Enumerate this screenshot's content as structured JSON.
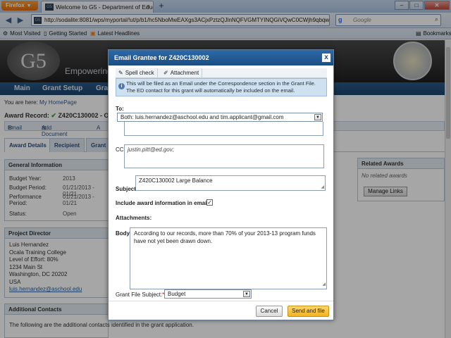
{
  "browser": {
    "app_button": "Firefox",
    "tab_title": "Welcome to G5 - Department of Educatio...",
    "tab_close": "×",
    "new_tab": "+",
    "url": "http://sodalite:8081/wps/myportal/!ut/p/b1/hc5NboMwEAXgs3ACjxPztzQJlnNQFVGMTYINQGiVQwC0CWjh9qbqw",
    "search_placeholder": "Google",
    "window_controls": {
      "minimize": "–",
      "maximize": "□",
      "close": "✕"
    },
    "bookmarks": [
      "Most Visited",
      "Getting Started",
      "Latest Headlines"
    ],
    "bookmarks_menu": "Bookmarks"
  },
  "site": {
    "logo_text": "G5",
    "tagline": "Empowering",
    "nav": [
      "Main",
      "Grant Setup",
      "Gra"
    ],
    "breadcrumb_prefix": "You are here:",
    "breadcrumb_link": "My HomePage",
    "award_record": "Award Record:",
    "award_id": "Z420C130002 - Oca",
    "actions": [
      "Email",
      "Add Document",
      "A"
    ],
    "tabs": [
      "Award Details",
      "Recipient",
      "Grant"
    ],
    "general_info": {
      "title": "General Information",
      "rows": [
        {
          "label": "Budget Year:",
          "value": "2013"
        },
        {
          "label": "Budget Period:",
          "value": "01/21/2013 - 01/21"
        },
        {
          "label": "Performance Period:",
          "value": "01/21/2013 - 01/21"
        },
        {
          "label": "Status:",
          "value": "Open"
        }
      ]
    },
    "project_director": {
      "title": "Project Director",
      "lines": [
        "Luis Hernandez",
        "Ocala Training College",
        "Level of Effort: 80%",
        "1234 Main St",
        "Washington, DC 20202",
        "USA",
        "luis.hernandez@aschool.edu"
      ]
    },
    "additional_contacts": {
      "title": "Additional Contacts",
      "text": "The following are the additional contacts identified in the grant application."
    },
    "related_awards": {
      "title": "Related Awards",
      "empty": "No related awards",
      "button": "Manage Links"
    }
  },
  "dialog": {
    "title": "Email Grantee for Z420C130002",
    "close": "x",
    "toolbar": {
      "spell_check": "Spell check",
      "attachment": "Attachment"
    },
    "info_line1": "This will be filed as an Email under the Correspondence section in the Grant File.",
    "info_line2": "The ED contact for this grant will automatically be included on the email.",
    "to_label": "To:",
    "to_value": "Both: luis.hernandez@aschool.edu and tim.applicant@gmail.com",
    "cc_label": "CC:",
    "cc_value": "justin.pitt@ed.gov;",
    "subject_label": "Subject:",
    "subject_value": "Z420C130002 Large Balance",
    "include_label": "Include award information in email:",
    "include_checked": "✓",
    "attachments_label": "Attachments:",
    "body_label": "Body:",
    "body_value": "According to our records, more than 70% of your 2013-13 program funds have not yet been drawn down.",
    "grant_file_subject_label": "Grant File Subject:",
    "grant_file_subject_required": "*",
    "grant_file_subject_value": "Budget",
    "cancel": "Cancel",
    "send": "Send and file"
  }
}
